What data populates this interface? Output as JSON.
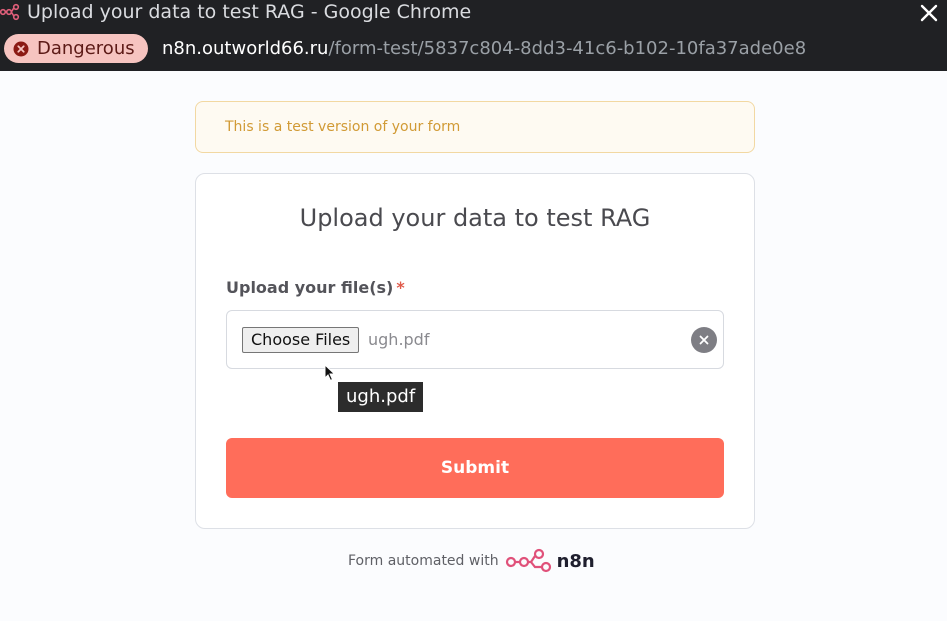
{
  "window": {
    "title": "Upload your data to test RAG - Google Chrome",
    "icon": "n8n-logo-icon",
    "close_icon": "close-icon"
  },
  "address_bar": {
    "security_label": "Dangerous",
    "security_icon": "warning-circle-icon",
    "url_host": "n8n.outworld66.ru",
    "url_path": "/form-test/5837c804-8dd3-41c6-b102-10fa37ade0e8"
  },
  "banner": {
    "text": "This is a test version of your form"
  },
  "form": {
    "title": "Upload your data to test RAG",
    "field_label": "Upload your file(s)",
    "required_mark": "*",
    "choose_files_label": "Choose Files",
    "selected_file": "ugh.pdf",
    "clear_icon": "clear-icon",
    "submit_label": "Submit"
  },
  "tooltip": {
    "text": "ugh.pdf"
  },
  "footer": {
    "text": "Form automated with",
    "brand": "n8n"
  },
  "colors": {
    "accent": "#ff6d5a",
    "banner_text": "#d19a35",
    "danger_chip": "#f6c4c0",
    "chrome_bg": "#202124"
  }
}
